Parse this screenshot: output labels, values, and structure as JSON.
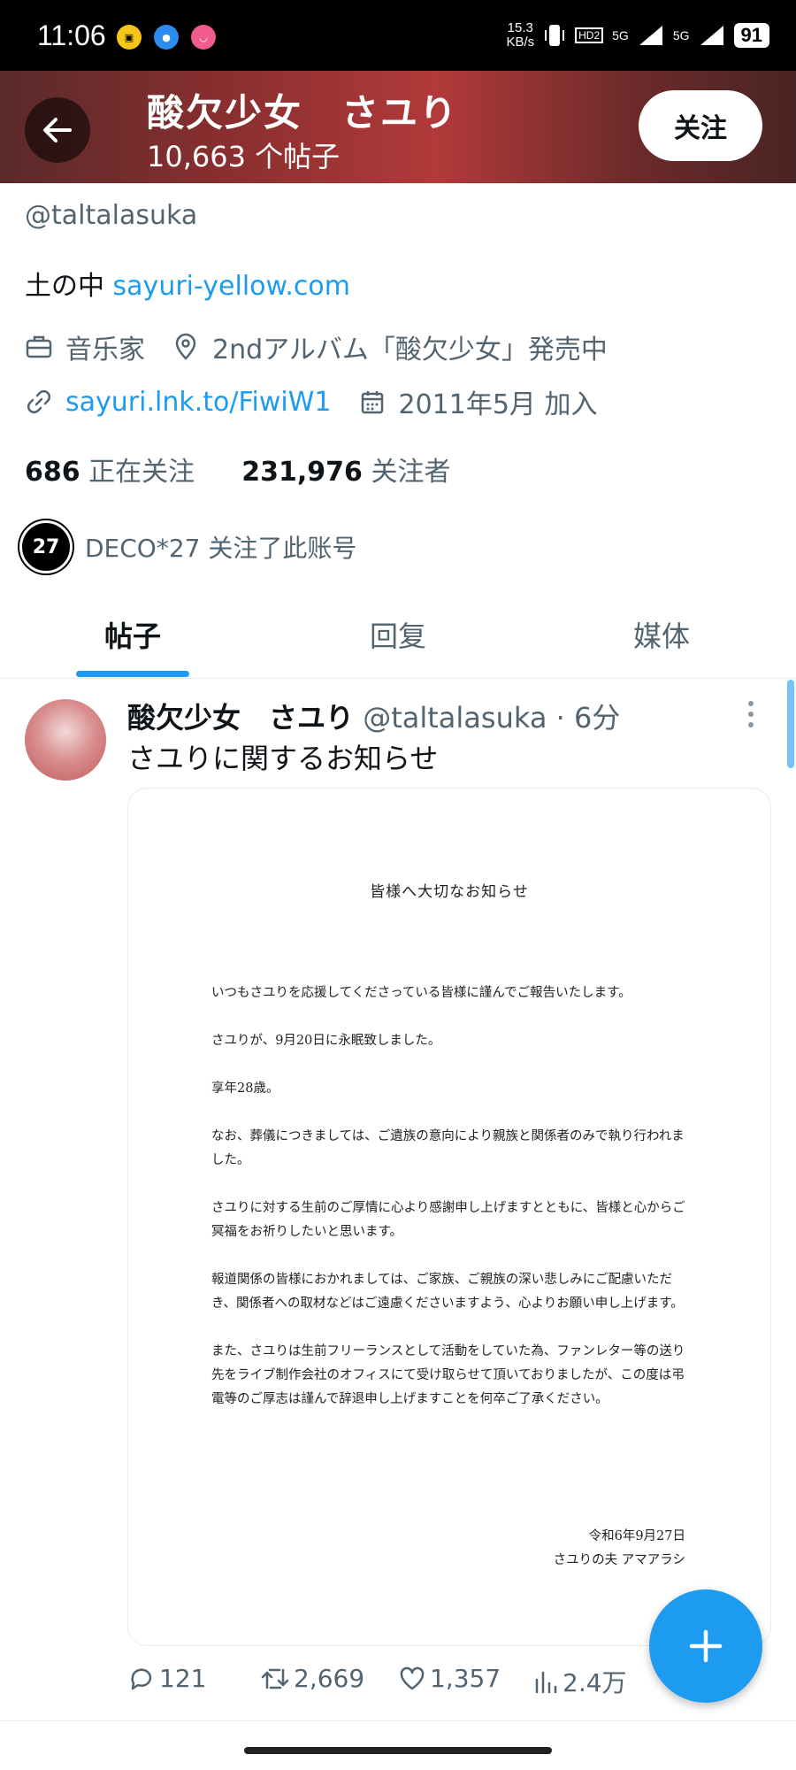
{
  "status_bar": {
    "time": "11:06",
    "net_speed_value": "15.3",
    "net_speed_unit": "KB/s",
    "signal1": "5G",
    "signal2": "5G",
    "hd_label": "HD2",
    "battery": "91"
  },
  "header": {
    "name": "酸欠少女　さユり",
    "post_count": "10,663 个帖子",
    "follow_label": "关注"
  },
  "profile": {
    "handle": "@taltalasuka",
    "bio_text": "土の中 ",
    "bio_link": "sayuri-yellow.com",
    "category": "音乐家",
    "location": "2ndアルバム「酸欠少女」発売中",
    "website": "sayuri.lnk.to/FiwiW1",
    "joined": "2011年5月 加入",
    "following_count": "686",
    "following_label": "正在关注",
    "followers_count": "231,976",
    "followers_label": "关注者",
    "followed_by_logo": "27",
    "followed_by_text": "DECO*27 关注了此账号"
  },
  "tabs": [
    {
      "label": "帖子",
      "active": true
    },
    {
      "label": "回复",
      "active": false
    },
    {
      "label": "媒体",
      "active": false
    }
  ],
  "tweet": {
    "name": "酸欠少女　さユり",
    "handle_time": "@taltalasuka · 6分",
    "text": "さユりに関するお知らせ",
    "notice": {
      "title": "皆様へ大切なお知らせ",
      "paragraphs": [
        "いつもさユりを応援してくださっている皆様に謹んでご報告いたします。",
        "さユりが、9月20日に永眠致しました。",
        "享年28歳。",
        "なお、葬儀につきましては、ご遺族の意向により親族と関係者のみで執り行われました。",
        "さユりに対する生前のご厚情に心より感謝申し上げますとともに、皆様と心からご冥福をお祈りしたいと思います。",
        "報道関係の皆様におかれましては、ご家族、ご親族の深い悲しみにご配慮いただき、関係者への取材などはご遠慮くださいますよう、心よりお願い申し上げます。",
        "また、さユりは生前フリーランスとして活動をしていた為、ファンレター等の送り先をライブ制作会社のオフィスにて受け取らせて頂いておりましたが、この度は弔電等のご厚志は謹んで辞退申し上げますことを何卒ご了承ください。"
      ],
      "date": "令和6年9月27日",
      "signature": "さユりの夫 アマアラシ"
    },
    "replies": "121",
    "reposts": "2,669",
    "likes": "1,357",
    "views": "2.4万"
  },
  "colors": {
    "accent": "#1d9bf0",
    "text_primary": "#0f1419",
    "text_secondary": "#536471"
  }
}
